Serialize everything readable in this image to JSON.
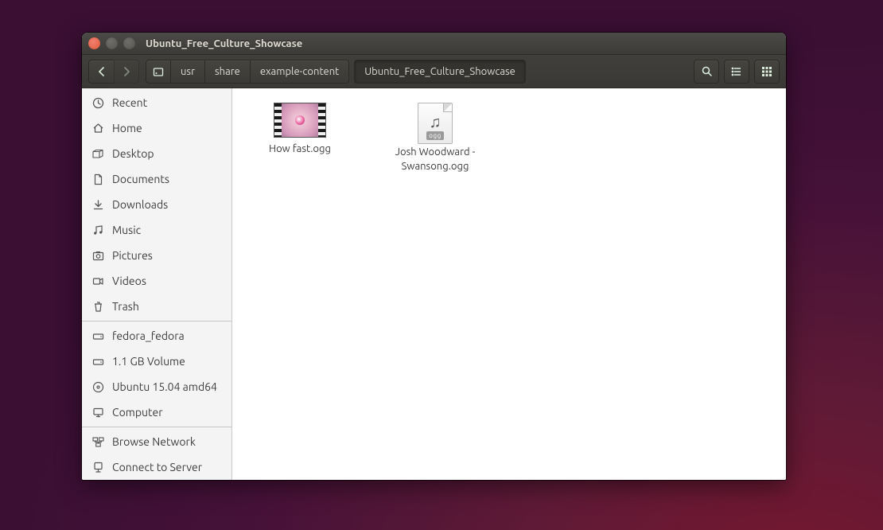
{
  "window": {
    "title": "Ubuntu_Free_Culture_Showcase"
  },
  "path": {
    "segments": [
      "usr",
      "share",
      "example-content"
    ],
    "current": "Ubuntu_Free_Culture_Showcase"
  },
  "sidebar": {
    "places": [
      {
        "icon": "recent",
        "label": "Recent"
      },
      {
        "icon": "home",
        "label": "Home"
      },
      {
        "icon": "desktop",
        "label": "Desktop"
      },
      {
        "icon": "documents",
        "label": "Documents"
      },
      {
        "icon": "downloads",
        "label": "Downloads"
      },
      {
        "icon": "music",
        "label": "Music"
      },
      {
        "icon": "pictures",
        "label": "Pictures"
      },
      {
        "icon": "videos",
        "label": "Videos"
      },
      {
        "icon": "trash",
        "label": "Trash"
      }
    ],
    "devices": [
      {
        "icon": "drive",
        "label": "fedora_fedora"
      },
      {
        "icon": "drive",
        "label": "1.1 GB Volume"
      },
      {
        "icon": "disc",
        "label": "Ubuntu 15.04 amd64"
      },
      {
        "icon": "computer",
        "label": "Computer"
      }
    ],
    "network": [
      {
        "icon": "network",
        "label": "Browse Network"
      },
      {
        "icon": "server",
        "label": "Connect to Server"
      }
    ]
  },
  "files": [
    {
      "type": "video",
      "label": "How fast.ogg"
    },
    {
      "type": "audio",
      "label": "Josh Woodward - Swansong.ogg",
      "badge": "ogg"
    }
  ]
}
